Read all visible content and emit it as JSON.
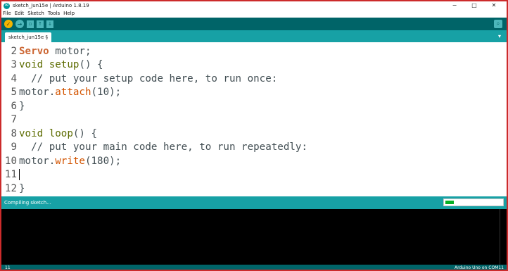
{
  "window": {
    "title": "sketch_jun15e | Arduino 1.8.19",
    "controls": {
      "minimize": "−",
      "maximize": "□",
      "close": "✕"
    }
  },
  "menu": [
    "File",
    "Edit",
    "Sketch",
    "Tools",
    "Help"
  ],
  "toolbar": {
    "verify_icon": "✓",
    "upload_icon": "→",
    "new_icon": "▫",
    "open_icon": "↑",
    "save_icon": "↓",
    "serial_monitor_icon": "⌕"
  },
  "tab": {
    "label": "sketch_jun15e §",
    "menu_icon": "▾"
  },
  "editor": {
    "lines": [
      {
        "num": "2",
        "tokens": [
          [
            "kw-type",
            "Servo"
          ],
          [
            "code-text",
            " motor;"
          ]
        ]
      },
      {
        "num": "3",
        "tokens": [
          [
            "kw-fn",
            "void"
          ],
          [
            "code-text",
            " "
          ],
          [
            "kw-fn",
            "setup"
          ],
          [
            "code-text",
            "() {"
          ]
        ]
      },
      {
        "num": "4",
        "tokens": [
          [
            "comment",
            "  // put your setup code here, to run once:"
          ]
        ]
      },
      {
        "num": "5",
        "tokens": [
          [
            "code-text",
            "motor."
          ],
          [
            "kw-call",
            "attach"
          ],
          [
            "code-text",
            "(10);"
          ]
        ]
      },
      {
        "num": "6",
        "tokens": [
          [
            "code-text",
            "}"
          ]
        ]
      },
      {
        "num": "7",
        "tokens": []
      },
      {
        "num": "8",
        "tokens": [
          [
            "kw-fn",
            "void"
          ],
          [
            "code-text",
            " "
          ],
          [
            "kw-fn",
            "loop"
          ],
          [
            "code-text",
            "() {"
          ]
        ]
      },
      {
        "num": "9",
        "tokens": [
          [
            "comment",
            "  // put your main code here, to run repeatedly:"
          ]
        ]
      },
      {
        "num": "10",
        "tokens": [
          [
            "code-text",
            "motor."
          ],
          [
            "kw-call",
            "write"
          ],
          [
            "code-text",
            "(180);"
          ]
        ]
      },
      {
        "num": "11",
        "tokens": [],
        "cursor": true
      },
      {
        "num": "12",
        "tokens": [
          [
            "code-text",
            "}"
          ]
        ]
      }
    ]
  },
  "status": {
    "message": "Compiling sketch...",
    "progress": 0.15
  },
  "footer": {
    "line_number": "11",
    "board": "Arduino Uno on COM11"
  },
  "colors": {
    "toolbar": "#006468",
    "teal": "#17a1a5",
    "keyword_type": "#cc6633",
    "keyword_fn": "#5e6d03",
    "keyword_call": "#d35400",
    "progress_fill": "#06b025"
  }
}
